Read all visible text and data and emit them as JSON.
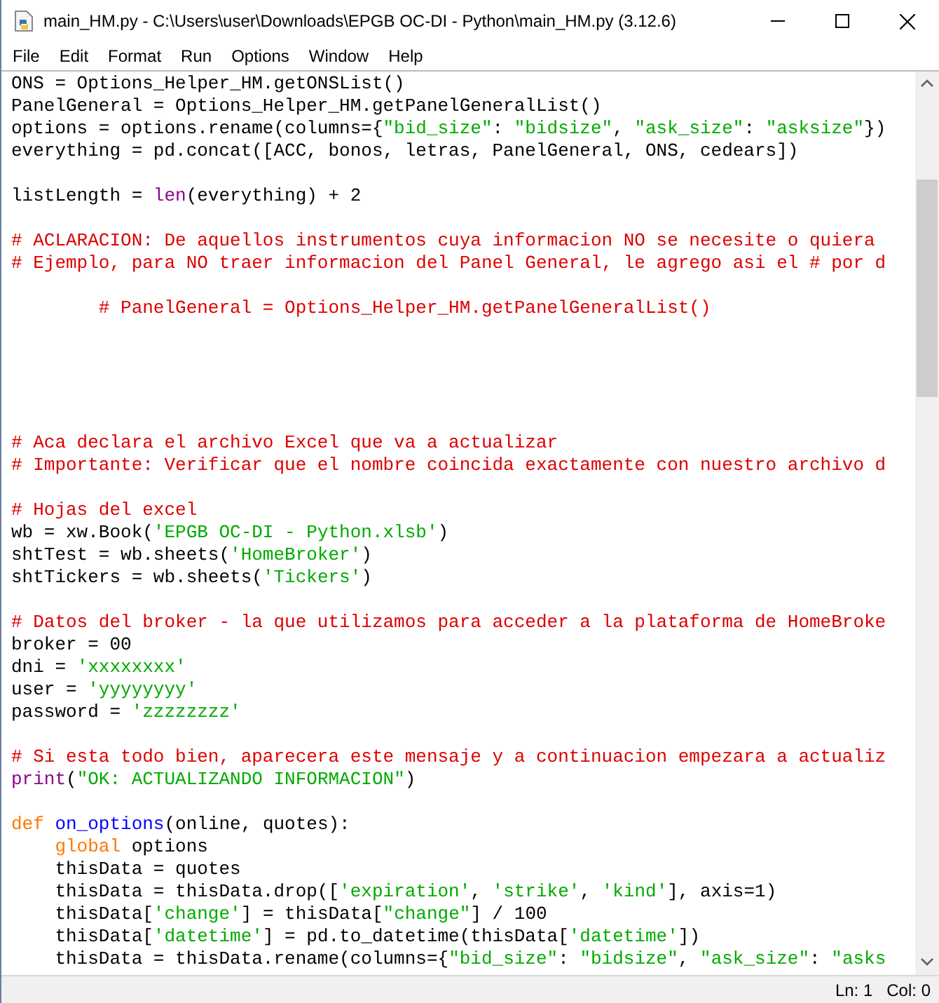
{
  "window": {
    "title": "main_HM.py - C:\\Users\\user\\Downloads\\EPGB OC-DI - Python\\main_HM.py (3.12.6)"
  },
  "menu": [
    "File",
    "Edit",
    "Format",
    "Run",
    "Options",
    "Window",
    "Help"
  ],
  "editor": {
    "lines": [
      {
        "kind": "code",
        "segments": [
          {
            "kind": "plain",
            "text": "ONS = Options_Helper_HM.getONSList()"
          }
        ]
      },
      {
        "kind": "code",
        "segments": [
          {
            "kind": "plain",
            "text": "PanelGeneral = Options_Helper_HM.getPanelGeneralList()"
          }
        ]
      },
      {
        "kind": "code",
        "segments": [
          {
            "kind": "plain",
            "text": "options = options.rename(columns={"
          },
          {
            "kind": "string",
            "text": "\"bid_size\""
          },
          {
            "kind": "plain",
            "text": ": "
          },
          {
            "kind": "string",
            "text": "\"bidsize\""
          },
          {
            "kind": "plain",
            "text": ", "
          },
          {
            "kind": "string",
            "text": "\"ask_size\""
          },
          {
            "kind": "plain",
            "text": ": "
          },
          {
            "kind": "string",
            "text": "\"asksize\""
          },
          {
            "kind": "plain",
            "text": "})"
          }
        ]
      },
      {
        "kind": "code",
        "segments": [
          {
            "kind": "plain",
            "text": "everything = pd.concat([ACC, bonos, letras, PanelGeneral, ONS, cedears])"
          }
        ]
      },
      {
        "kind": "blank"
      },
      {
        "kind": "code",
        "segments": [
          {
            "kind": "plain",
            "text": "listLength = "
          },
          {
            "kind": "builtin",
            "text": "len"
          },
          {
            "kind": "plain",
            "text": "(everything) + 2"
          }
        ]
      },
      {
        "kind": "blank"
      },
      {
        "kind": "code",
        "segments": [
          {
            "kind": "comment",
            "text": "# ACLARACION: De aquellos instrumentos cuya informacion NO se necesite o quiera"
          }
        ]
      },
      {
        "kind": "code",
        "segments": [
          {
            "kind": "comment",
            "text": "# Ejemplo, para NO traer informacion del Panel General, le agrego asi el # por d"
          }
        ]
      },
      {
        "kind": "blank"
      },
      {
        "kind": "code",
        "segments": [
          {
            "kind": "comment",
            "text": "        # PanelGeneral = Options_Helper_HM.getPanelGeneralList()"
          }
        ]
      },
      {
        "kind": "blank"
      },
      {
        "kind": "blank"
      },
      {
        "kind": "blank"
      },
      {
        "kind": "blank"
      },
      {
        "kind": "blank"
      },
      {
        "kind": "code",
        "segments": [
          {
            "kind": "comment",
            "text": "# Aca declara el archivo Excel que va a actualizar"
          }
        ]
      },
      {
        "kind": "code",
        "segments": [
          {
            "kind": "comment",
            "text": "# Importante: Verificar que el nombre coincida exactamente con nuestro archivo d"
          }
        ]
      },
      {
        "kind": "blank"
      },
      {
        "kind": "code",
        "segments": [
          {
            "kind": "comment",
            "text": "# Hojas del excel"
          }
        ]
      },
      {
        "kind": "code",
        "segments": [
          {
            "kind": "plain",
            "text": "wb = xw.Book("
          },
          {
            "kind": "string",
            "text": "'EPGB OC-DI - Python.xlsb'"
          },
          {
            "kind": "plain",
            "text": ")"
          }
        ]
      },
      {
        "kind": "code",
        "segments": [
          {
            "kind": "plain",
            "text": "shtTest = wb.sheets("
          },
          {
            "kind": "string",
            "text": "'HomeBroker'"
          },
          {
            "kind": "plain",
            "text": ")"
          }
        ]
      },
      {
        "kind": "code",
        "segments": [
          {
            "kind": "plain",
            "text": "shtTickers = wb.sheets("
          },
          {
            "kind": "string",
            "text": "'Tickers'"
          },
          {
            "kind": "plain",
            "text": ")"
          }
        ]
      },
      {
        "kind": "blank"
      },
      {
        "kind": "code",
        "segments": [
          {
            "kind": "comment",
            "text": "# Datos del broker - la que utilizamos para acceder a la plataforma de HomeBroke"
          }
        ]
      },
      {
        "kind": "code",
        "segments": [
          {
            "kind": "plain",
            "text": "broker = 00"
          }
        ]
      },
      {
        "kind": "code",
        "segments": [
          {
            "kind": "plain",
            "text": "dni = "
          },
          {
            "kind": "string",
            "text": "'xxxxxxxx'"
          }
        ]
      },
      {
        "kind": "code",
        "segments": [
          {
            "kind": "plain",
            "text": "user = "
          },
          {
            "kind": "string",
            "text": "'yyyyyyyy'"
          }
        ]
      },
      {
        "kind": "code",
        "segments": [
          {
            "kind": "plain",
            "text": "password = "
          },
          {
            "kind": "string",
            "text": "'zzzzzzzz'"
          }
        ]
      },
      {
        "kind": "blank"
      },
      {
        "kind": "code",
        "segments": [
          {
            "kind": "comment",
            "text": "# Si esta todo bien, aparecera este mensaje y a continuacion empezara a actualiz"
          }
        ]
      },
      {
        "kind": "code",
        "segments": [
          {
            "kind": "builtin",
            "text": "print"
          },
          {
            "kind": "plain",
            "text": "("
          },
          {
            "kind": "string",
            "text": "\"OK: ACTUALIZANDO INFORMACION\""
          },
          {
            "kind": "plain",
            "text": ")"
          }
        ]
      },
      {
        "kind": "blank"
      },
      {
        "kind": "code",
        "segments": [
          {
            "kind": "keyword",
            "text": "def"
          },
          {
            "kind": "definition",
            "text": " on_options"
          },
          {
            "kind": "plain",
            "text": "(online, quotes):"
          }
        ]
      },
      {
        "kind": "code",
        "segments": [
          {
            "kind": "keyword",
            "text": "    global"
          },
          {
            "kind": "plain",
            "text": " options"
          }
        ]
      },
      {
        "kind": "code",
        "segments": [
          {
            "kind": "plain",
            "text": "    thisData = quotes"
          }
        ]
      },
      {
        "kind": "code",
        "segments": [
          {
            "kind": "plain",
            "text": "    thisData = thisData.drop(["
          },
          {
            "kind": "string",
            "text": "'expiration'"
          },
          {
            "kind": "plain",
            "text": ", "
          },
          {
            "kind": "string",
            "text": "'strike'"
          },
          {
            "kind": "plain",
            "text": ", "
          },
          {
            "kind": "string",
            "text": "'kind'"
          },
          {
            "kind": "plain",
            "text": "], axis=1)"
          }
        ]
      },
      {
        "kind": "code",
        "segments": [
          {
            "kind": "plain",
            "text": "    thisData["
          },
          {
            "kind": "string",
            "text": "'change'"
          },
          {
            "kind": "plain",
            "text": "] = thisData["
          },
          {
            "kind": "string",
            "text": "\"change\""
          },
          {
            "kind": "plain",
            "text": "] / 100"
          }
        ]
      },
      {
        "kind": "code",
        "segments": [
          {
            "kind": "plain",
            "text": "    thisData["
          },
          {
            "kind": "string",
            "text": "'datetime'"
          },
          {
            "kind": "plain",
            "text": "] = pd.to_datetime(thisData["
          },
          {
            "kind": "string",
            "text": "'datetime'"
          },
          {
            "kind": "plain",
            "text": "])"
          }
        ]
      },
      {
        "kind": "code",
        "segments": [
          {
            "kind": "plain",
            "text": "    thisData = thisData.rename(columns={"
          },
          {
            "kind": "string",
            "text": "\"bid_size\""
          },
          {
            "kind": "plain",
            "text": ": "
          },
          {
            "kind": "string",
            "text": "\"bidsize\""
          },
          {
            "kind": "plain",
            "text": ", "
          },
          {
            "kind": "string",
            "text": "\"ask_size\""
          },
          {
            "kind": "plain",
            "text": ": "
          },
          {
            "kind": "string",
            "text": "\"asks"
          }
        ]
      }
    ]
  },
  "status_bar": {
    "line": "Ln: 1",
    "column": "Col: 0"
  }
}
